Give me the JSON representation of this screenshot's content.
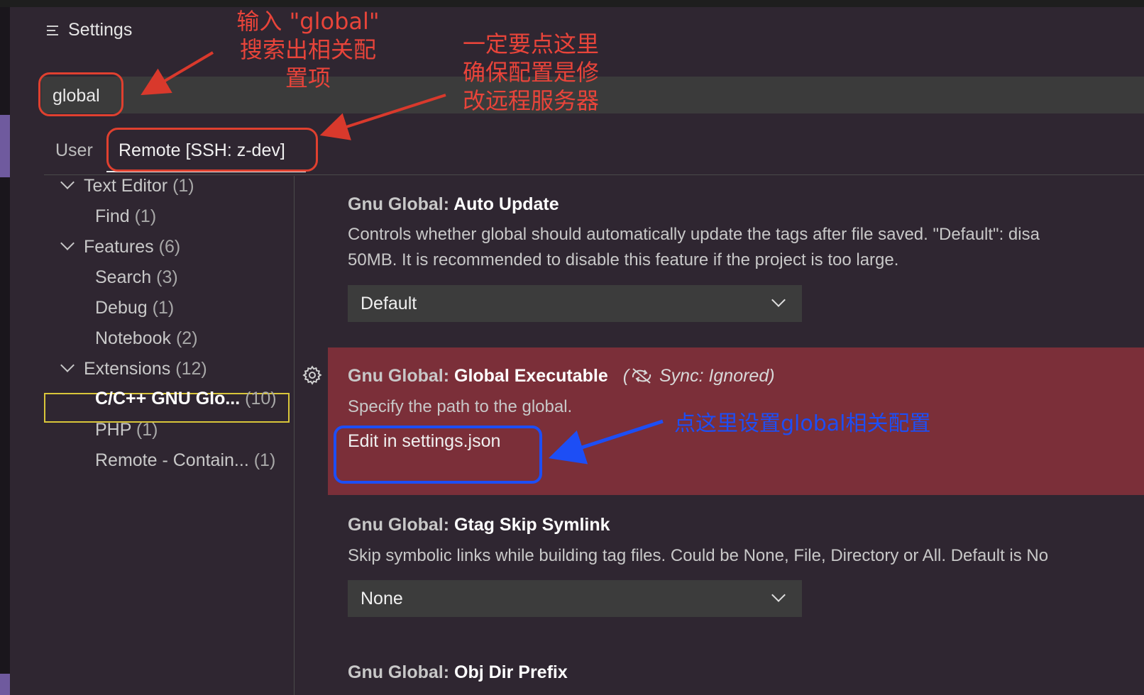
{
  "header": {
    "title": "Settings"
  },
  "search": {
    "value": "global"
  },
  "tabs": [
    {
      "label": "User",
      "active": false
    },
    {
      "label": "Remote [SSH: z-dev]",
      "active": true
    }
  ],
  "toc": [
    {
      "label": "Text Editor",
      "count": "(1)",
      "expanded": true
    },
    {
      "label": "Find",
      "count": "(1)"
    },
    {
      "label": "Features",
      "count": "(6)",
      "expanded": true
    },
    {
      "label": "Search",
      "count": "(3)"
    },
    {
      "label": "Debug",
      "count": "(1)"
    },
    {
      "label": "Notebook",
      "count": "(2)"
    },
    {
      "label": "Extensions",
      "count": "(12)",
      "expanded": true
    },
    {
      "label": "C/C++ GNU Glo...",
      "count": "(10)",
      "selected": true
    },
    {
      "label": "PHP",
      "count": "(1)"
    },
    {
      "label": "Remote - Contain...",
      "count": "(1)"
    }
  ],
  "settings": [
    {
      "category": "Gnu Global: ",
      "name": "Auto Update",
      "description_lines": [
        "Controls whether global should automatically update the tags after file saved. \"Default\": disa",
        "50MB. It is recommended to disable this feature if the project is too large."
      ],
      "dropdown_value": "Default"
    },
    {
      "category": "Gnu Global: ",
      "name": "Global Executable",
      "sync_note": "Sync: Ignored)",
      "sync_prefix": "(",
      "description": "Specify the path to the global.",
      "link": "Edit in settings.json",
      "modified": true
    },
    {
      "category": "Gnu Global: ",
      "name": "Gtag Skip Symlink",
      "description": "Skip symbolic links while building tag files. Could be None, File, Directory or All. Default is No",
      "dropdown_value": "None"
    },
    {
      "category": "Gnu Global: ",
      "name": "Obj Dir Prefix"
    }
  ],
  "annotations": {
    "search_note": [
      "输入 \"global\"",
      "搜索出相关配",
      "置项"
    ],
    "remote_note": [
      "一定要点这里",
      "确保配置是修",
      "改远程服务器"
    ],
    "edit_note": "点这里设置global相关配置"
  },
  "colors": {
    "annotation_red": "#e8443a",
    "annotation_blue": "#1d4ef5",
    "modified_bg": "#7b2f39",
    "selection_border": "#d9c63a"
  },
  "icons": [
    "menu-icon",
    "chevron-down-icon",
    "gear-icon",
    "sync-ignored-icon"
  ]
}
